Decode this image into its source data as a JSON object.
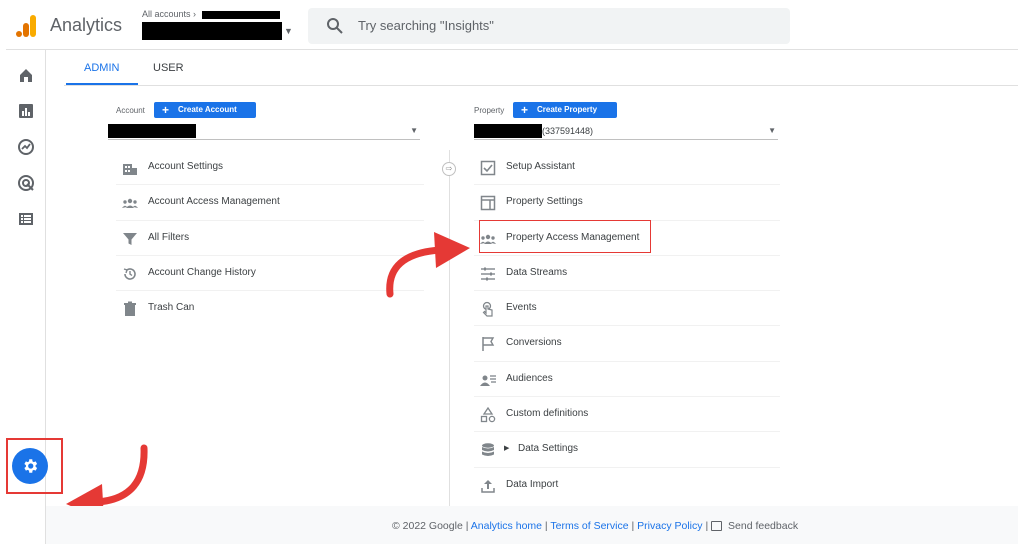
{
  "header": {
    "app_name": "Analytics",
    "breadcrumb_label": "All accounts",
    "search_placeholder": "Try searching \"Insights\""
  },
  "tabs": [
    {
      "label": "ADMIN",
      "active": true
    },
    {
      "label": "USER",
      "active": false
    }
  ],
  "account_column": {
    "label": "Account",
    "create_button": "Create Account",
    "items": [
      {
        "label": "Account Settings",
        "icon": "building-icon"
      },
      {
        "label": "Account Access Management",
        "icon": "people-icon"
      },
      {
        "label": "All Filters",
        "icon": "filter-icon"
      },
      {
        "label": "Account Change History",
        "icon": "history-icon"
      },
      {
        "label": "Trash Can",
        "icon": "trash-icon"
      }
    ]
  },
  "property_column": {
    "label": "Property",
    "create_button": "Create Property",
    "selected_suffix": "(337591448)",
    "items": [
      {
        "label": "Setup Assistant",
        "icon": "checkbox-icon"
      },
      {
        "label": "Property Settings",
        "icon": "layout-icon"
      },
      {
        "label": "Property Access Management",
        "icon": "people-icon"
      },
      {
        "label": "Data Streams",
        "icon": "streams-icon"
      },
      {
        "label": "Events",
        "icon": "touch-icon"
      },
      {
        "label": "Conversions",
        "icon": "flag-icon"
      },
      {
        "label": "Audiences",
        "icon": "audience-icon"
      },
      {
        "label": "Custom definitions",
        "icon": "shapes-icon"
      },
      {
        "label": "Data Settings",
        "icon": "database-icon"
      },
      {
        "label": "Data Import",
        "icon": "upload-icon"
      }
    ]
  },
  "footer": {
    "copyright": "© 2022 Google",
    "link_home": "Analytics home",
    "link_terms": "Terms of Service",
    "link_privacy": "Privacy Policy",
    "feedback": "Send feedback"
  },
  "colors": {
    "accent": "#1a73e8",
    "highlight": "#e53935",
    "logo_orange": "#f9ab00",
    "logo_dark": "#e37400"
  }
}
